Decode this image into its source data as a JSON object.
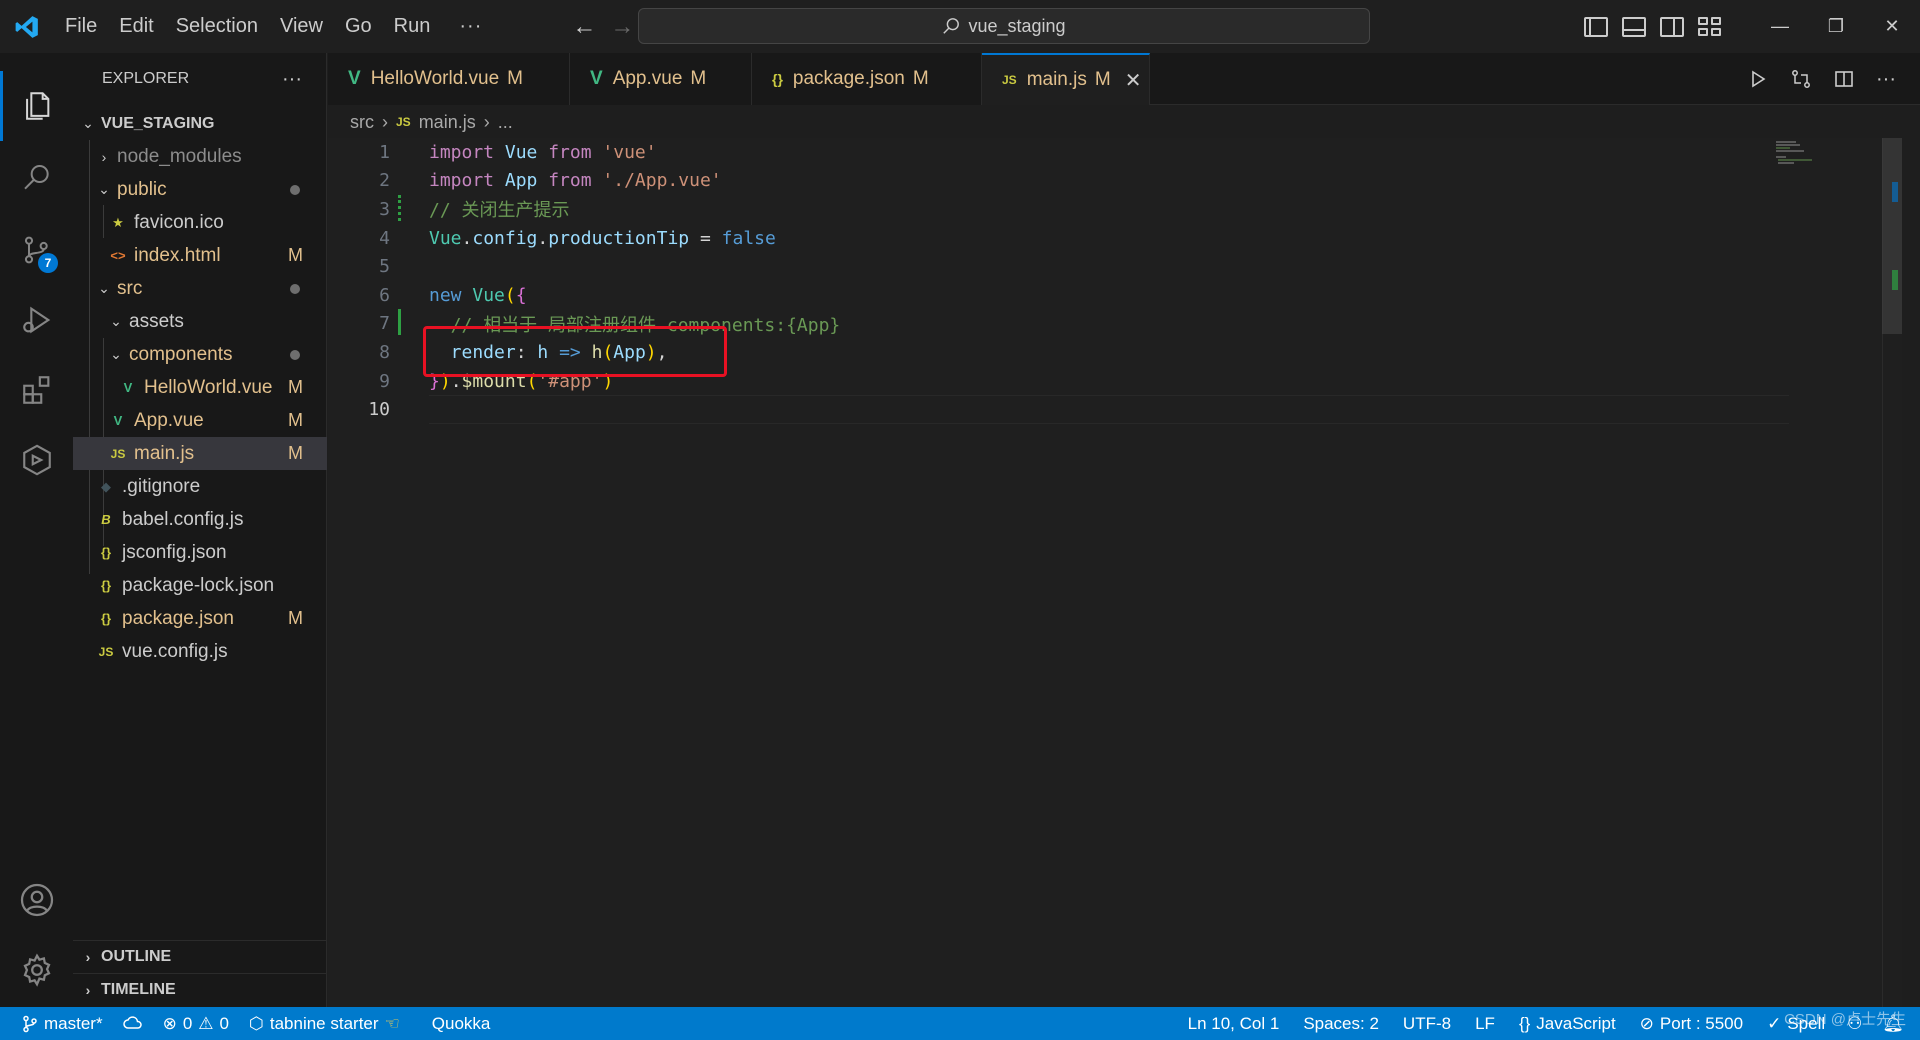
{
  "menu": [
    "File",
    "Edit",
    "Selection",
    "View",
    "Go",
    "Run",
    "···"
  ],
  "search": {
    "text": "vue_staging"
  },
  "explorer": {
    "title": "EXPLORER",
    "more": "···",
    "folder": "VUE_STAGING",
    "items": [
      {
        "label": "node_modules",
        "icon": "",
        "mark": ""
      },
      {
        "label": "public",
        "icon": "",
        "mark": "●"
      },
      {
        "label": "favicon.ico",
        "icon": "★",
        "mark": ""
      },
      {
        "label": "index.html",
        "icon": "<>",
        "mark": "M"
      },
      {
        "label": "src",
        "icon": "",
        "mark": "●"
      },
      {
        "label": "assets",
        "icon": "",
        "mark": ""
      },
      {
        "label": "components",
        "icon": "",
        "mark": "●"
      },
      {
        "label": "HelloWorld.vue",
        "icon": "V",
        "mark": "M"
      },
      {
        "label": "App.vue",
        "icon": "V",
        "mark": "M"
      },
      {
        "label": "main.js",
        "icon": "JS",
        "mark": "M"
      },
      {
        "label": ".gitignore",
        "icon": "◆",
        "mark": ""
      },
      {
        "label": "babel.config.js",
        "icon": "B",
        "mark": ""
      },
      {
        "label": "jsconfig.json",
        "icon": "{}",
        "mark": ""
      },
      {
        "label": "package-lock.json",
        "icon": "{}",
        "mark": ""
      },
      {
        "label": "package.json",
        "icon": "{}",
        "mark": "M"
      },
      {
        "label": "vue.config.js",
        "icon": "JS",
        "mark": ""
      }
    ],
    "outline": "OUTLINE",
    "timeline": "TIMELINE"
  },
  "activity_badge": "7",
  "tabs": [
    {
      "label": "HelloWorld.vue",
      "icon": "V",
      "mark": "M"
    },
    {
      "label": "App.vue",
      "icon": "V",
      "mark": "M"
    },
    {
      "label": "package.json",
      "icon": "{}",
      "mark": "M"
    },
    {
      "label": "main.js",
      "icon": "JS",
      "mark": "M",
      "close": "✕"
    }
  ],
  "breadcrumb": {
    "folder": "src",
    "icon": "JS",
    "file": "main.js",
    "tail": "..."
  },
  "code": {
    "line_numbers": [
      "1",
      "2",
      "3",
      "4",
      "5",
      "6",
      "7",
      "8",
      "9",
      "10"
    ],
    "l1": {
      "kw": "import",
      "name": " Vue ",
      "from": "from",
      "str": " 'vue'"
    },
    "l2": {
      "kw": "import",
      "name": " App ",
      "from": "from",
      "str": " './App.vue'"
    },
    "l3": {
      "cmt": "// 关闭生产提示"
    },
    "l4": {
      "obj": "Vue",
      "dot1": ".",
      "p1": "config",
      "dot2": ".",
      "p2": "productionTip",
      "eq": " = ",
      "val": "false"
    },
    "l6": {
      "kw": "new",
      "cls": " Vue",
      "open": "(",
      "brace": "{"
    },
    "l7": {
      "cmt": "  // 相当于 局部注册组件 components:{App}"
    },
    "l8": {
      "prop": "  render",
      "colon": ": ",
      "param": "h",
      "arrow": " => ",
      "fn": "h",
      "open": "(",
      "arg": "App",
      "close": ")",
      "comma": ","
    },
    "l9": {
      "brace": "}",
      "close": ")",
      "dot": ".",
      "fn": "$mount",
      "open": "(",
      "str": "'#app'",
      "end": ")"
    }
  },
  "status": {
    "branch": "master*",
    "errors": "0",
    "warnings": "0",
    "tabnine": "tabnine starter",
    "quokka": "Quokka",
    "position": "Ln 10, Col 1",
    "spaces": "Spaces: 2",
    "encoding": "UTF-8",
    "eol": "LF",
    "language": "JavaScript",
    "port": "Port : 5500",
    "spell": "Spell"
  },
  "watermark": "CSDN @卢士先生",
  "colors": {
    "accent": "#0078d4",
    "statusbar": "#007acc",
    "modified": "#e2c08d",
    "highlight": "#e81123"
  }
}
